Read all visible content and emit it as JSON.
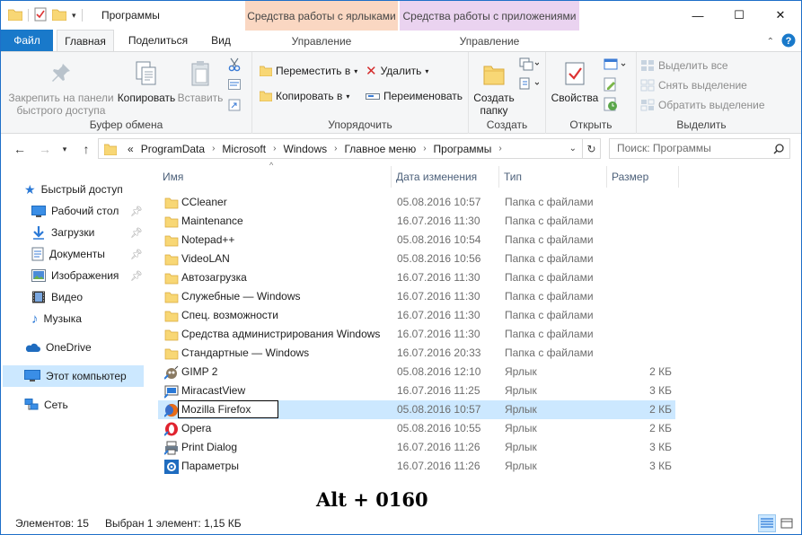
{
  "window": {
    "title": "Программы",
    "contextual_tabs": [
      {
        "label": "Средства работы с ярлыками",
        "sub": "Управление"
      },
      {
        "label": "Средства работы с приложениями",
        "sub": "Управление"
      }
    ],
    "controls": {
      "minimize": "—",
      "maximize": "☐",
      "close": "✕"
    }
  },
  "ribbon_tabs": {
    "file": "Файл",
    "items": [
      "Главная",
      "Поделиться",
      "Вид"
    ],
    "active": "Главная"
  },
  "ribbon": {
    "clipboard": {
      "label": "Буфер обмена",
      "pin": "Закрепить на панели быстрого доступа",
      "copy": "Копировать",
      "paste": "Вставить"
    },
    "organize": {
      "label": "Упорядочить",
      "move": "Переместить в",
      "copy_to": "Копировать в",
      "delete": "Удалить",
      "rename": "Переименовать"
    },
    "create": {
      "label": "Создать",
      "new_folder": "Создать папку"
    },
    "open": {
      "label": "Открыть",
      "properties": "Свойства"
    },
    "select": {
      "label": "Выделить",
      "select_all": "Выделить все",
      "select_none": "Снять выделение",
      "invert": "Обратить выделение"
    }
  },
  "address": {
    "prefix": "«",
    "crumbs": [
      "ProgramData",
      "Microsoft",
      "Windows",
      "Главное меню",
      "Программы"
    ],
    "search_placeholder": "Поиск: Программы"
  },
  "nav": {
    "quick_access": "Быстрый доступ",
    "items": [
      {
        "label": "Рабочий стол",
        "pinned": true,
        "icon": "desktop-icon"
      },
      {
        "label": "Загрузки",
        "pinned": true,
        "icon": "downloads-icon"
      },
      {
        "label": "Документы",
        "pinned": true,
        "icon": "documents-icon"
      },
      {
        "label": "Изображения",
        "pinned": true,
        "icon": "pictures-icon"
      },
      {
        "label": "Видео",
        "pinned": false,
        "icon": "video-icon"
      },
      {
        "label": "Музыка",
        "pinned": false,
        "icon": "music-icon"
      }
    ],
    "onedrive": "OneDrive",
    "this_pc": "Этот компьютер",
    "network": "Сеть"
  },
  "columns": {
    "name": "Имя",
    "date": "Дата изменения",
    "type": "Тип",
    "size": "Размер"
  },
  "files": [
    {
      "name": "CCleaner",
      "date": "05.08.2016 10:57",
      "type": "Папка с файлами",
      "size": "",
      "icon": "folder-icon"
    },
    {
      "name": "Maintenance",
      "date": "16.07.2016 11:30",
      "type": "Папка с файлами",
      "size": "",
      "icon": "folder-icon"
    },
    {
      "name": "Notepad++",
      "date": "05.08.2016 10:54",
      "type": "Папка с файлами",
      "size": "",
      "icon": "folder-icon"
    },
    {
      "name": "VideoLAN",
      "date": "05.08.2016 10:56",
      "type": "Папка с файлами",
      "size": "",
      "icon": "folder-icon"
    },
    {
      "name": "Автозагрузка",
      "date": "16.07.2016 11:30",
      "type": "Папка с файлами",
      "size": "",
      "icon": "folder-icon"
    },
    {
      "name": "Служебные — Windows",
      "date": "16.07.2016 11:30",
      "type": "Папка с файлами",
      "size": "",
      "icon": "folder-icon"
    },
    {
      "name": "Спец. возможности",
      "date": "16.07.2016 11:30",
      "type": "Папка с файлами",
      "size": "",
      "icon": "folder-icon"
    },
    {
      "name": "Средства администрирования Windows",
      "date": "16.07.2016 11:30",
      "type": "Папка с файлами",
      "size": "",
      "icon": "folder-icon"
    },
    {
      "name": "Стандартные — Windows",
      "date": "16.07.2016 20:33",
      "type": "Папка с файлами",
      "size": "",
      "icon": "folder-icon"
    },
    {
      "name": "GIMP 2",
      "date": "05.08.2016 12:10",
      "type": "Ярлык",
      "size": "2 КБ",
      "icon": "gimp-icon"
    },
    {
      "name": "MiracastView",
      "date": "16.07.2016 11:25",
      "type": "Ярлык",
      "size": "3 КБ",
      "icon": "miracast-icon"
    },
    {
      "name": "Mozilla Firefox",
      "date": "05.08.2016 10:57",
      "type": "Ярлык",
      "size": "2 КБ",
      "icon": "firefox-icon",
      "selected": true,
      "renaming": true
    },
    {
      "name": "Opera",
      "date": "05.08.2016 10:55",
      "type": "Ярлык",
      "size": "2 КБ",
      "icon": "opera-icon"
    },
    {
      "name": "Print Dialog",
      "date": "16.07.2016 11:26",
      "type": "Ярлык",
      "size": "3 КБ",
      "icon": "print-icon"
    },
    {
      "name": "Параметры",
      "date": "16.07.2016 11:26",
      "type": "Ярлык",
      "size": "3 КБ",
      "icon": "settings-icon"
    }
  ],
  "overlay_text": "Alt + 0160",
  "status": {
    "count": "Элементов: 15",
    "selection": "Выбран 1 элемент: 1,15 КБ"
  },
  "colors": {
    "accent": "#1979ca",
    "selection": "#cce8ff",
    "folder": "#f8d775"
  }
}
